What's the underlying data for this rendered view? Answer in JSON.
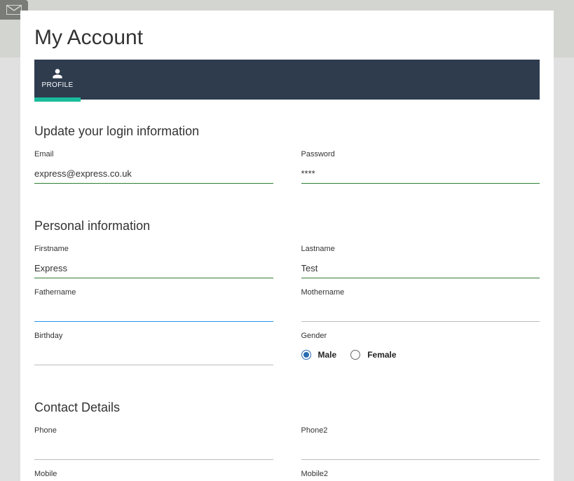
{
  "page": {
    "title": "My Account"
  },
  "tabs": {
    "profile": "PROFILE"
  },
  "sections": {
    "login": {
      "title": "Update your login information"
    },
    "personal": {
      "title": "Personal information"
    },
    "contact": {
      "title": "Contact Details"
    }
  },
  "fields": {
    "email": {
      "label": "Email",
      "value": "express@express.co.uk"
    },
    "password": {
      "label": "Password",
      "value": "****"
    },
    "firstname": {
      "label": "Firstname",
      "value": "Express"
    },
    "lastname": {
      "label": "Lastname",
      "value": "Test"
    },
    "fathername": {
      "label": "Fathername",
      "value": ""
    },
    "mothername": {
      "label": "Mothername",
      "value": ""
    },
    "birthday": {
      "label": "Birthday",
      "value": ""
    },
    "gender": {
      "label": "Gender",
      "male": "Male",
      "female": "Female",
      "selected": "male"
    },
    "phone": {
      "label": "Phone",
      "value": ""
    },
    "phone2": {
      "label": "Phone2",
      "value": ""
    },
    "mobile": {
      "label": "Mobile",
      "value": ""
    },
    "mobile2": {
      "label": "Mobile2",
      "value": ""
    }
  }
}
